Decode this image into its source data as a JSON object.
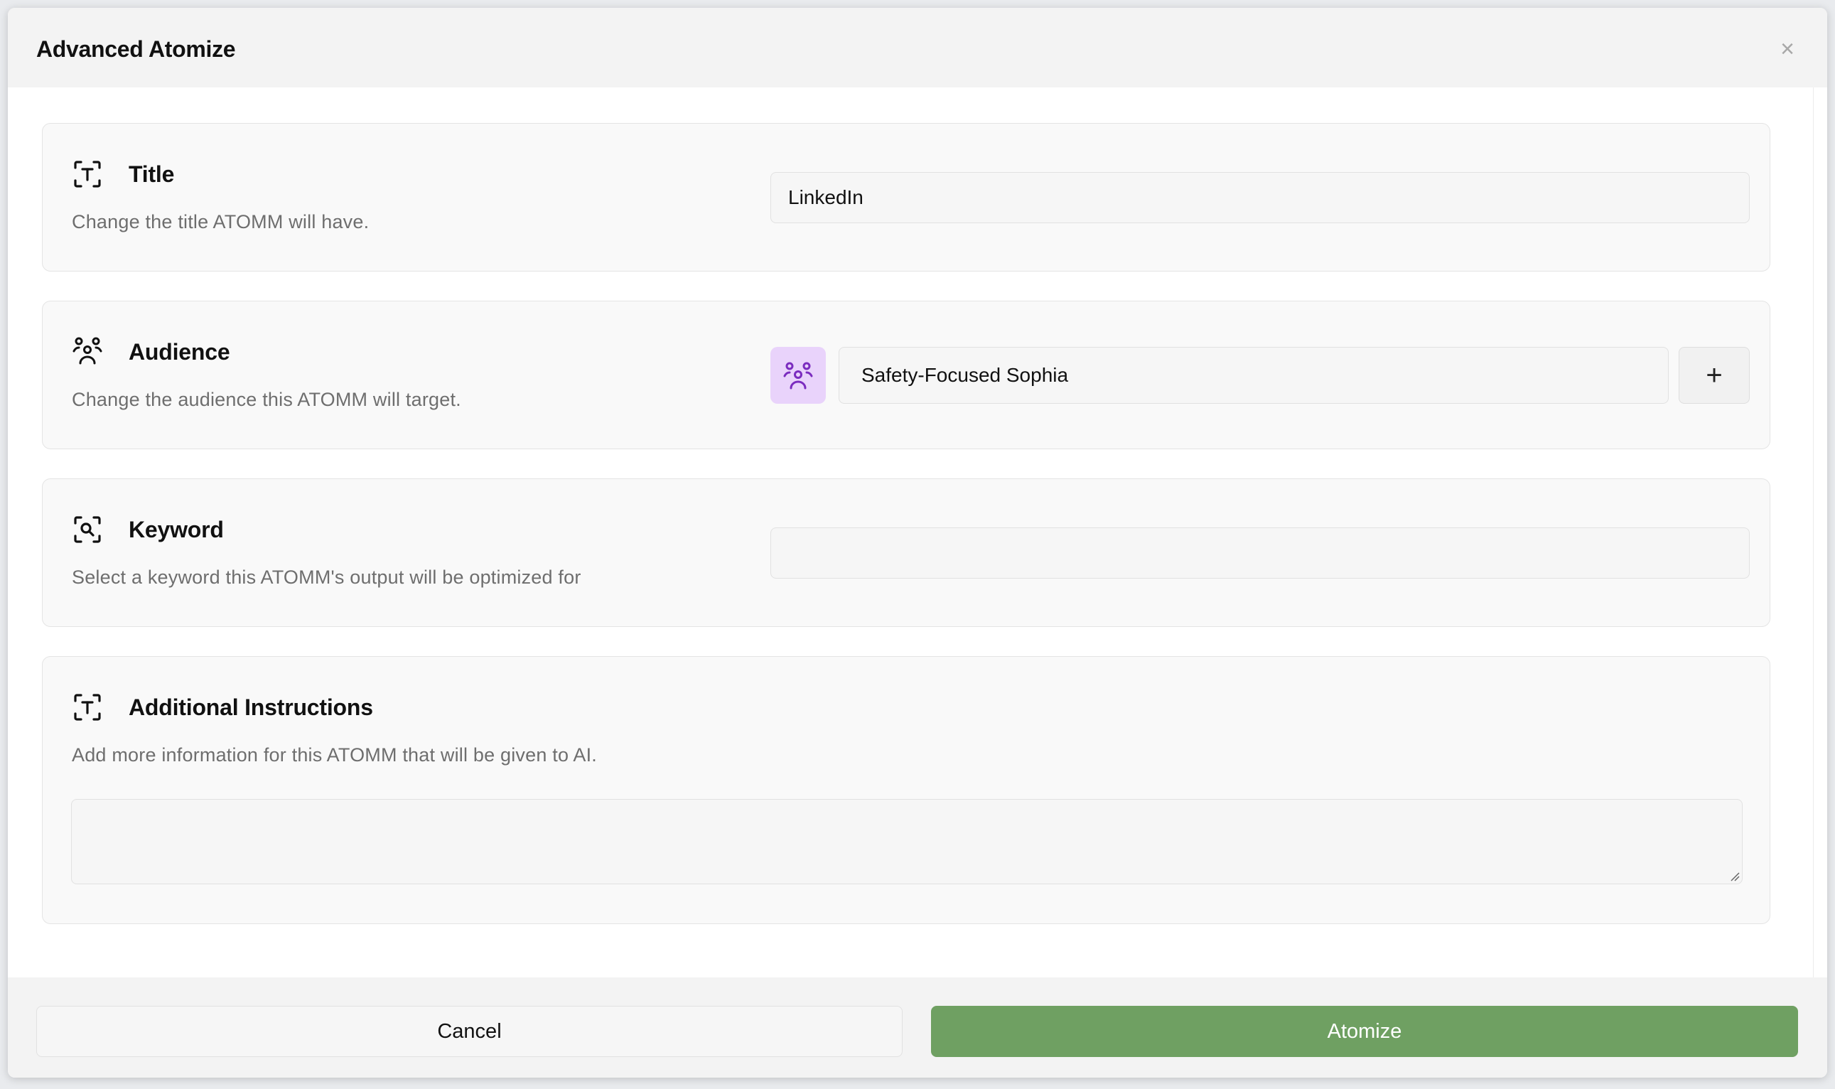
{
  "modal": {
    "title": "Advanced Atomize",
    "close_label": "×"
  },
  "sections": {
    "title": {
      "heading": "Title",
      "description": "Change the title ATOMM will have.",
      "input_value": "LinkedIn",
      "icon": "text-frame-icon"
    },
    "audience": {
      "heading": "Audience",
      "description": "Change the audience this ATOMM will target.",
      "selected_value": "Safety-Focused Sophia",
      "add_label": "+",
      "icon": "audience-group-icon"
    },
    "keyword": {
      "heading": "Keyword",
      "description": "Select a keyword this ATOMM's output will be optimized for",
      "input_value": "",
      "icon": "search-frame-icon"
    },
    "instructions": {
      "heading": "Additional Instructions",
      "description": "Add more information for this ATOMM that will be given to AI.",
      "textarea_value": "",
      "icon": "text-frame-icon"
    }
  },
  "footer": {
    "cancel_label": "Cancel",
    "submit_label": "Atomize"
  },
  "colors": {
    "primary_button": "#6fa062",
    "audience_avatar_bg": "#e9d3fb",
    "audience_avatar_icon": "#7b2cbf"
  }
}
